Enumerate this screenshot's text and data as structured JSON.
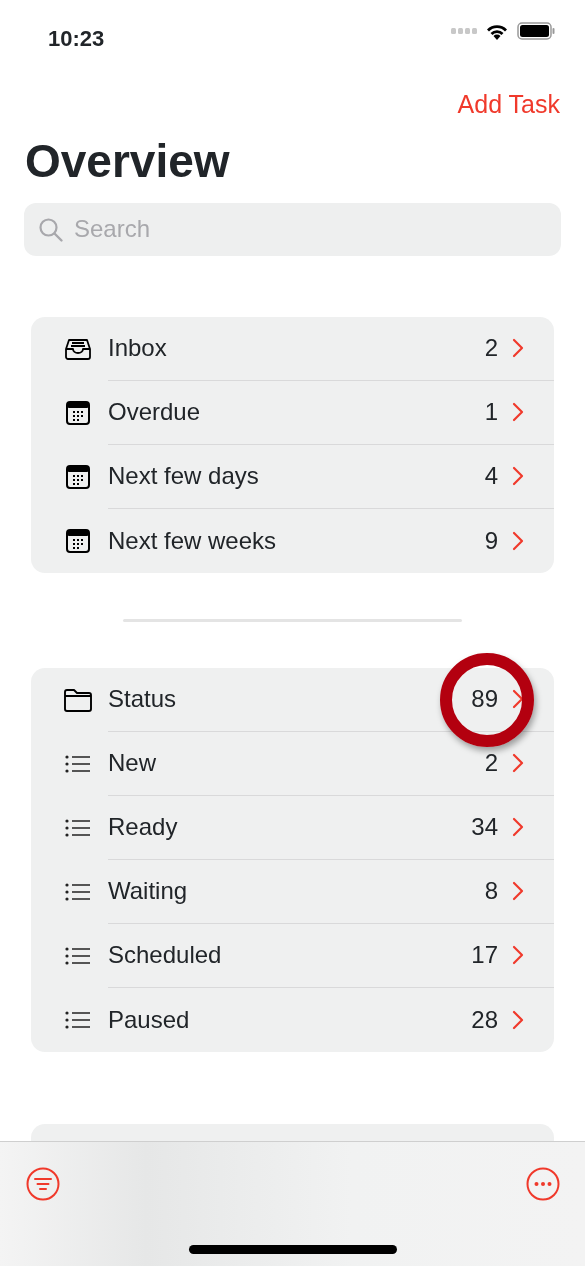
{
  "status_bar": {
    "time": "10:23"
  },
  "nav": {
    "action": "Add Task",
    "title": "Overview"
  },
  "search": {
    "placeholder": "Search"
  },
  "sections": [
    {
      "items": [
        {
          "kind": "inbox",
          "label": "Inbox",
          "count": "2",
          "highlighted": false
        },
        {
          "kind": "calendar",
          "label": "Overdue",
          "count": "1",
          "highlighted": false
        },
        {
          "kind": "calendar",
          "label": "Next few days",
          "count": "4",
          "highlighted": false
        },
        {
          "kind": "calendar",
          "label": "Next few weeks",
          "count": "9",
          "highlighted": false
        }
      ]
    },
    {
      "items": [
        {
          "kind": "folder",
          "label": "Status",
          "count": "89",
          "highlighted": true
        },
        {
          "kind": "list",
          "label": "New",
          "count": "2",
          "highlighted": false
        },
        {
          "kind": "list",
          "label": "Ready",
          "count": "34",
          "highlighted": false
        },
        {
          "kind": "list",
          "label": "Waiting",
          "count": "8",
          "highlighted": false
        },
        {
          "kind": "list",
          "label": "Scheduled",
          "count": "17",
          "highlighted": false
        },
        {
          "kind": "list",
          "label": "Paused",
          "count": "28",
          "highlighted": false
        }
      ]
    }
  ]
}
